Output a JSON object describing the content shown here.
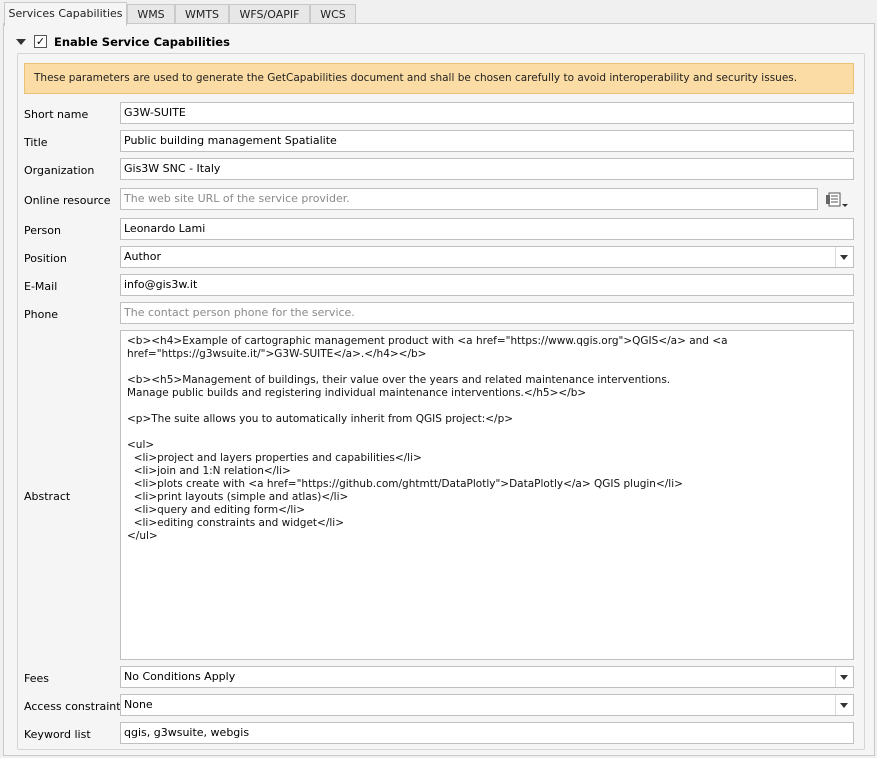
{
  "tabs": [
    "Services Capabilities",
    "WMS",
    "WMTS",
    "WFS/OAPIF",
    "WCS"
  ],
  "group": {
    "title": "Enable Service Capabilities",
    "checked": true
  },
  "warning": "These parameters are used to generate the GetCapabilities document and shall be chosen carefully to avoid interoperability and security issues.",
  "labels": {
    "short_name": "Short name",
    "title": "Title",
    "organization": "Organization",
    "online_resource": "Online resource",
    "person": "Person",
    "position": "Position",
    "email": "E-Mail",
    "phone": "Phone",
    "abstract": "Abstract",
    "fees": "Fees",
    "access_constraints": "Access constraints",
    "keyword_list": "Keyword list"
  },
  "values": {
    "short_name": "G3W-SUITE",
    "title": "Public building management Spatialite",
    "organization": "Gis3W SNC - Italy",
    "person": "Leonardo Lami",
    "position": "Author",
    "email": "info@gis3w.it",
    "fees": "No Conditions Apply",
    "access_constraints": "None",
    "keyword_list": "qgis, g3wsuite, webgis",
    "abstract": "<b><h4>Example of cartographic management product with <a href=\"https://www.qgis.org\">QGIS</a> and <a href=\"https://g3wsuite.it/\">G3W-SUITE</a>.</h4></b>\n\n<b><h5>Management of buildings, their value over the years and related maintenance interventions.\nManage public builds and registering individual maintenance interventions.</h5></b>\n\n<p>The suite allows you to automatically inherit from QGIS project:</p>\n\n<ul>\n  <li>project and layers properties and capabilities</li>\n  <li>join and 1:N relation</li>\n  <li>plots create with <a href=\"https://github.com/ghtmtt/DataPlotly\">DataPlotly</a> QGIS plugin</li>\n  <li>print layouts (simple and atlas)</li>\n  <li>query and editing form</li>\n  <li>editing constraints and widget</li>\n</ul>"
  },
  "placeholders": {
    "online_resource": "The web site URL of the service provider.",
    "phone": "The contact person phone for the service."
  },
  "icons": {
    "collapse": "chevron-down-icon",
    "expression": "expression-menu-icon"
  },
  "colors": {
    "warning_bg": "#fbdca4",
    "panel_bg": "#f5f5f5"
  }
}
